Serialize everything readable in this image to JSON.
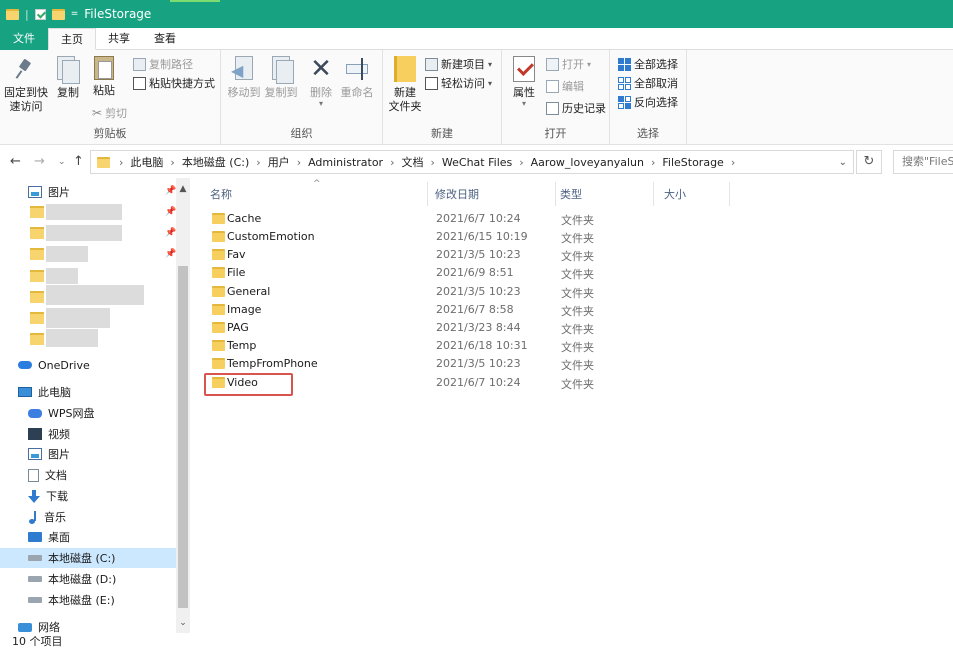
{
  "window": {
    "title": "FileStorage",
    "qa_separator": "="
  },
  "tabs": {
    "file": "文件",
    "home": "主页",
    "share": "共享",
    "view": "查看"
  },
  "ribbon": {
    "clipboard": {
      "label": "剪贴板",
      "pin": "固定到快速访问",
      "copy": "复制",
      "paste": "粘贴",
      "copy_path": "复制路径",
      "paste_shortcut": "粘贴快捷方式",
      "cut": "剪切"
    },
    "organize": {
      "label": "组织",
      "move_to": "移动到",
      "copy_to": "复制到",
      "delete": "删除",
      "rename": "重命名"
    },
    "new": {
      "label": "新建",
      "new_folder": "新建\n文件夹",
      "new_item": "新建项目",
      "easy_access": "轻松访问"
    },
    "open": {
      "label": "打开",
      "properties": "属性",
      "open": "打开",
      "edit": "编辑",
      "history": "历史记录"
    },
    "select": {
      "label": "选择",
      "select_all": "全部选择",
      "select_none": "全部取消",
      "invert": "反向选择"
    }
  },
  "address": {
    "breadcrumbs": [
      "此电脑",
      "本地磁盘 (C:)",
      "用户",
      "Administrator",
      "文档",
      "WeChat Files",
      "Aarow_loveyanyalun",
      "FileStorage"
    ],
    "search_placeholder": "搜索\"FileStorage\""
  },
  "nav": {
    "pictures_pinned": "图片",
    "onedrive": "OneDrive",
    "this_pc": "此电脑",
    "wps": "WPS网盘",
    "videos": "视频",
    "pictures": "图片",
    "documents": "文档",
    "downloads": "下载",
    "music": "音乐",
    "desktop": "桌面",
    "drive_c": "本地磁盘 (C:)",
    "drive_d": "本地磁盘 (D:)",
    "drive_e": "本地磁盘 (E:)",
    "network": "网络"
  },
  "columns": {
    "name": "名称",
    "modified": "修改日期",
    "type": "类型",
    "size": "大小"
  },
  "files": [
    {
      "name": "Cache",
      "modified": "2021/6/7 10:24",
      "type": "文件夹"
    },
    {
      "name": "CustomEmotion",
      "modified": "2021/6/15 10:19",
      "type": "文件夹"
    },
    {
      "name": "Fav",
      "modified": "2021/3/5 10:23",
      "type": "文件夹"
    },
    {
      "name": "File",
      "modified": "2021/6/9 8:51",
      "type": "文件夹"
    },
    {
      "name": "General",
      "modified": "2021/3/5 10:23",
      "type": "文件夹"
    },
    {
      "name": "Image",
      "modified": "2021/6/7 8:58",
      "type": "文件夹"
    },
    {
      "name": "PAG",
      "modified": "2021/3/23 8:44",
      "type": "文件夹"
    },
    {
      "name": "Temp",
      "modified": "2021/6/18 10:31",
      "type": "文件夹"
    },
    {
      "name": "TempFromPhone",
      "modified": "2021/3/5 10:23",
      "type": "文件夹"
    },
    {
      "name": "Video",
      "modified": "2021/6/7 10:24",
      "type": "文件夹"
    }
  ],
  "status": {
    "count": "10 个项目"
  },
  "colors": {
    "titlebar": "#17a382",
    "selection": "#cce8ff",
    "highlight": "#d9534f"
  }
}
